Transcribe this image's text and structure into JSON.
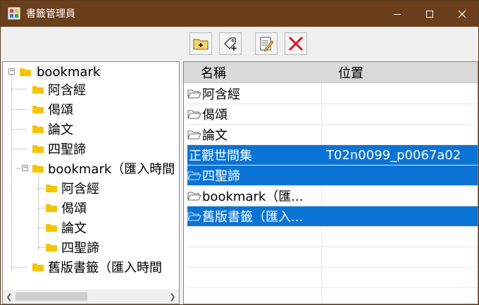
{
  "window": {
    "title": "書籤管理員"
  },
  "toolbar": {
    "buttons": [
      {
        "name": "new-folder",
        "icon": "folder-plus-icon"
      },
      {
        "name": "new-bookmark",
        "icon": "tag-plus-icon"
      },
      {
        "name": "edit",
        "icon": "notepad-edit-icon"
      },
      {
        "name": "delete",
        "icon": "red-x-icon"
      }
    ]
  },
  "tree": {
    "root_label": "bookmark",
    "items": [
      {
        "label": "阿含經"
      },
      {
        "label": "偈頌"
      },
      {
        "label": "論文"
      },
      {
        "label": "四聖諦"
      },
      {
        "label": "bookmark（匯入時間"
      },
      {
        "label": "阿含經"
      },
      {
        "label": "偈頌"
      },
      {
        "label": "論文"
      },
      {
        "label": "四聖諦"
      },
      {
        "label": "舊版書籤（匯入時間"
      }
    ]
  },
  "list": {
    "columns": {
      "name": "名稱",
      "location": "位置"
    },
    "rows": [
      {
        "name": "阿含經",
        "location": "",
        "is_folder": true,
        "selected": false
      },
      {
        "name": "偈頌",
        "location": "",
        "is_folder": true,
        "selected": false
      },
      {
        "name": "論文",
        "location": "",
        "is_folder": true,
        "selected": false
      },
      {
        "name": "正觀世間集",
        "location": "T02n0099_p0067a02",
        "is_folder": false,
        "selected": true
      },
      {
        "name": "四聖諦",
        "location": "",
        "is_folder": true,
        "selected": true
      },
      {
        "name": "bookmark（匯...",
        "location": "",
        "is_folder": true,
        "selected": false
      },
      {
        "name": "舊版書籤（匯入...",
        "location": "",
        "is_folder": true,
        "selected": true
      }
    ]
  },
  "colors": {
    "titlebar": "#6b3f1c",
    "selection": "#0a74d6",
    "folder": "#f5c400"
  }
}
